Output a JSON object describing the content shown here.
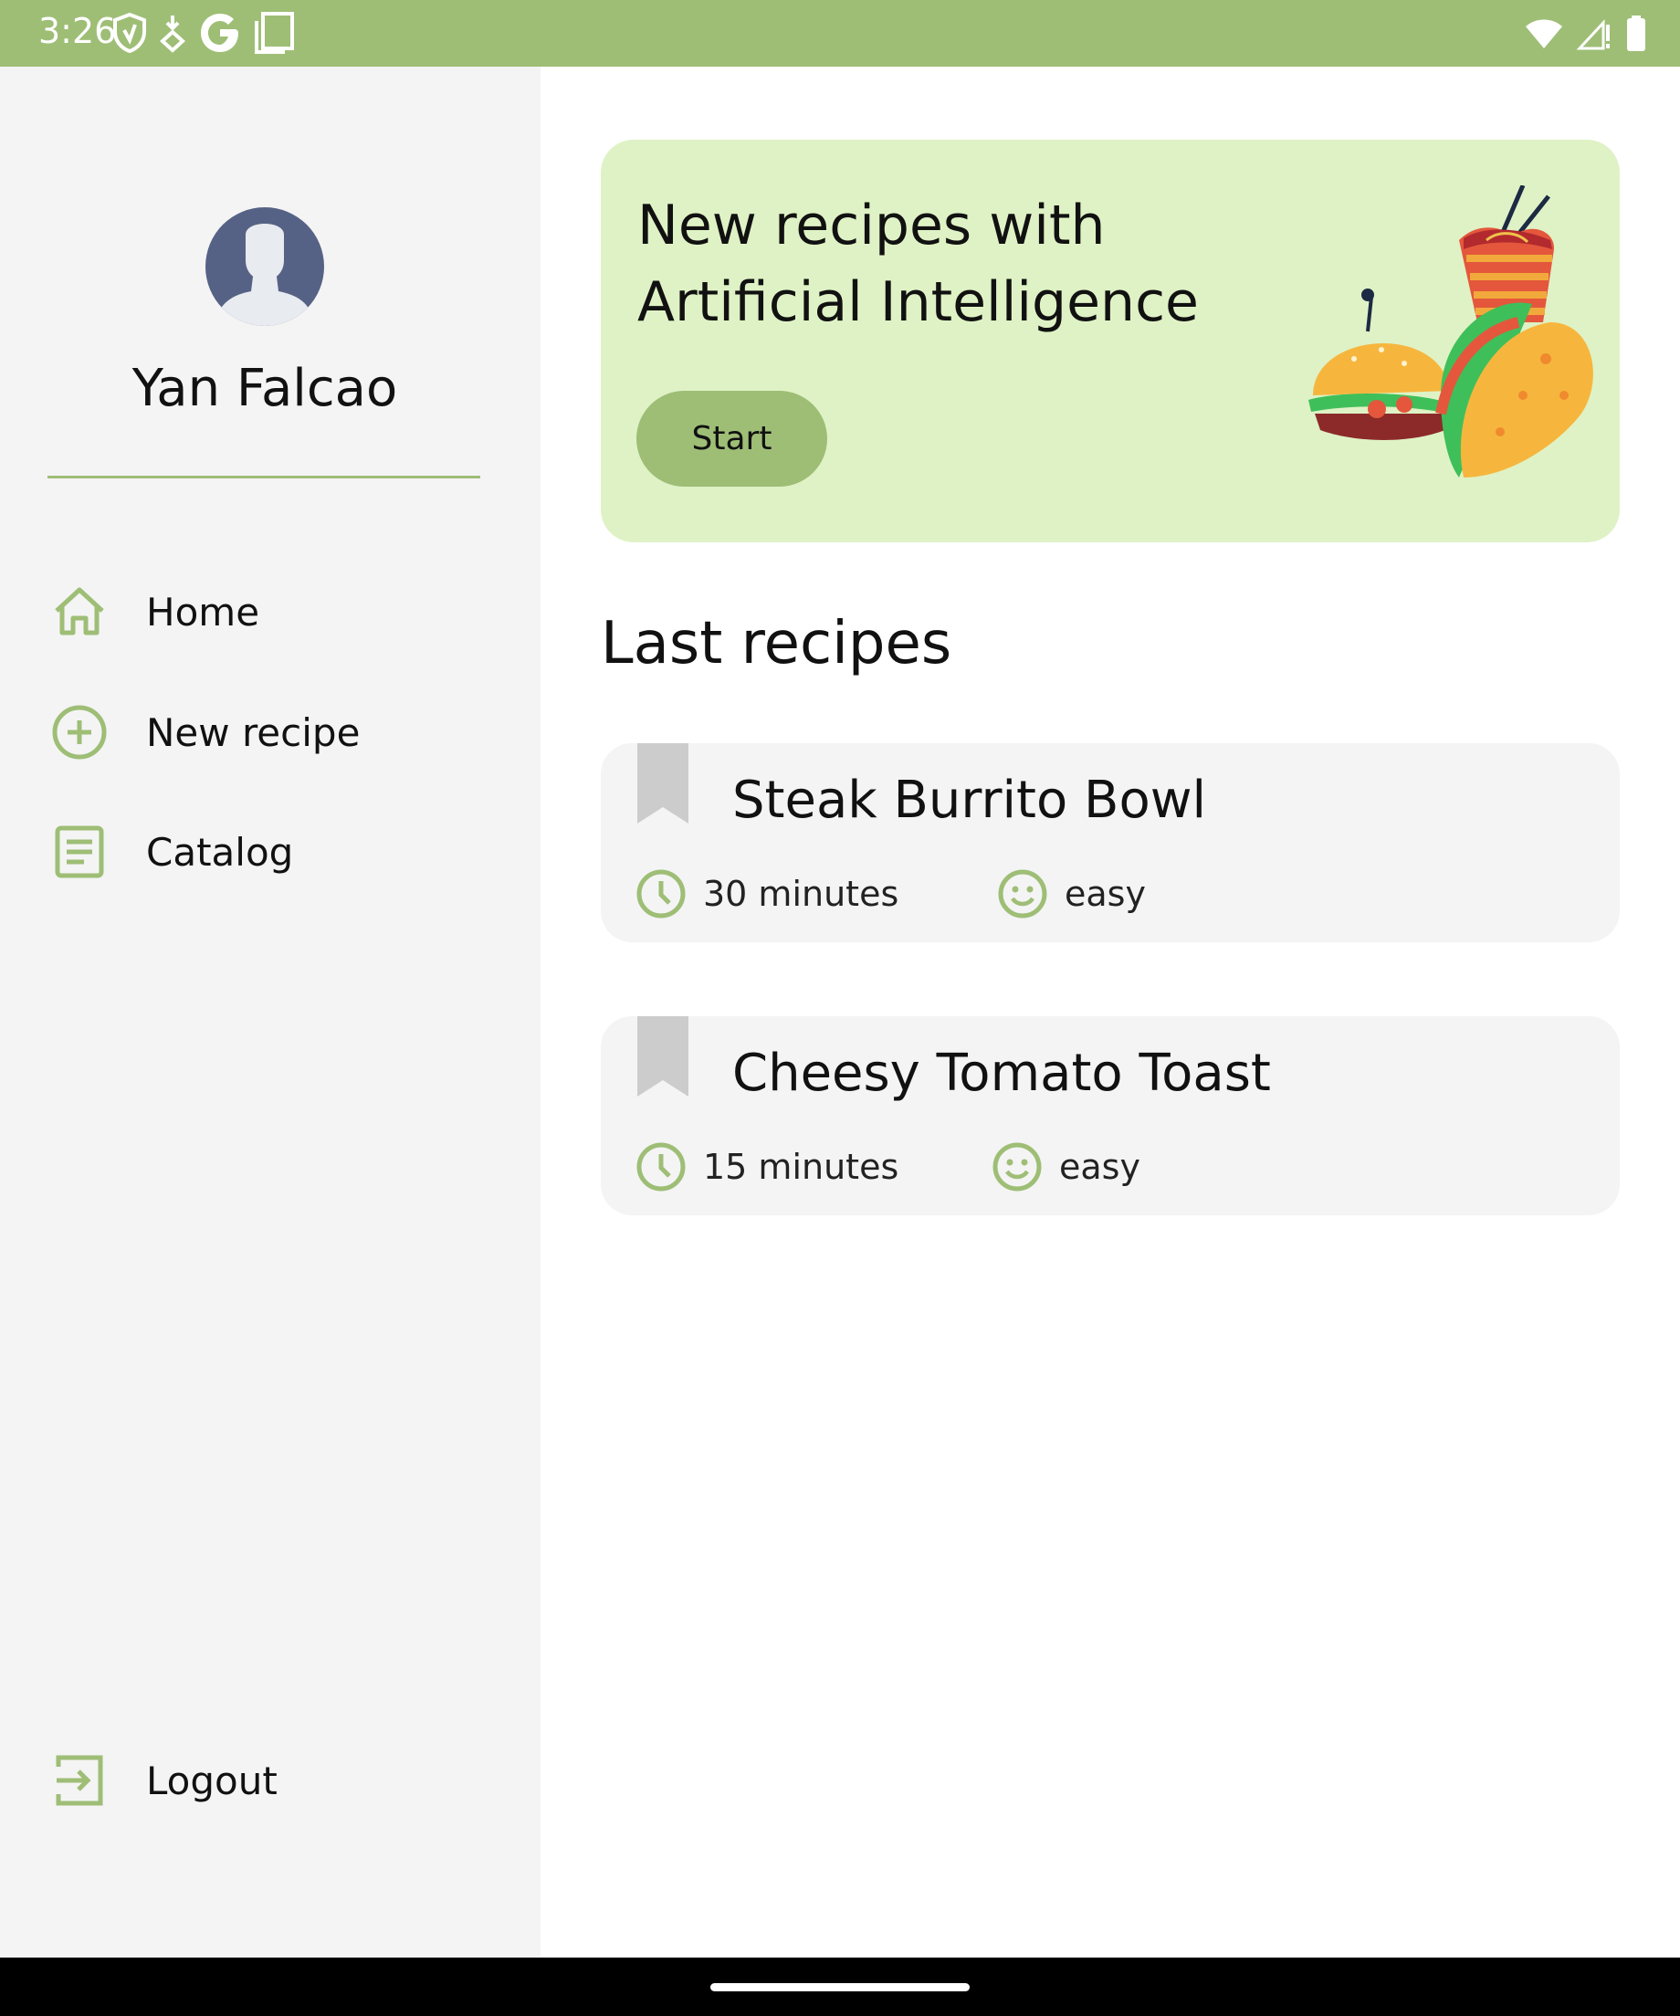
{
  "status_bar": {
    "time": "3:26",
    "left_icons": [
      "shield-icon",
      "download-icon",
      "google-icon",
      "screenshot-icon"
    ],
    "right_icons": [
      "wifi-icon",
      "signal-icon",
      "battery-icon"
    ]
  },
  "sidebar": {
    "user_name": "Yan Falcao",
    "items": [
      {
        "label": "Home",
        "icon": "home-icon"
      },
      {
        "label": "New recipe",
        "icon": "add-circle-icon"
      },
      {
        "label": "Catalog",
        "icon": "document-icon"
      }
    ],
    "logout_label": "Logout"
  },
  "hero": {
    "title_line1": "New recipes with",
    "title_line2": "Artificial Intelligence",
    "button_label": "Start"
  },
  "recipes_section": {
    "title": "Last recipes",
    "items": [
      {
        "name": "Steak Burrito Bowl",
        "time": "30 minutes",
        "difficulty": "easy"
      },
      {
        "name": "Cheesy Tomato Toast",
        "time": "15 minutes",
        "difficulty": "easy"
      }
    ]
  },
  "colors": {
    "accent": "#9ebe76",
    "hero_background": "#dff2c5",
    "sidebar_background": "#f4f4f4",
    "card_background": "#f4f4f4",
    "bookmark": "#cccccc"
  }
}
